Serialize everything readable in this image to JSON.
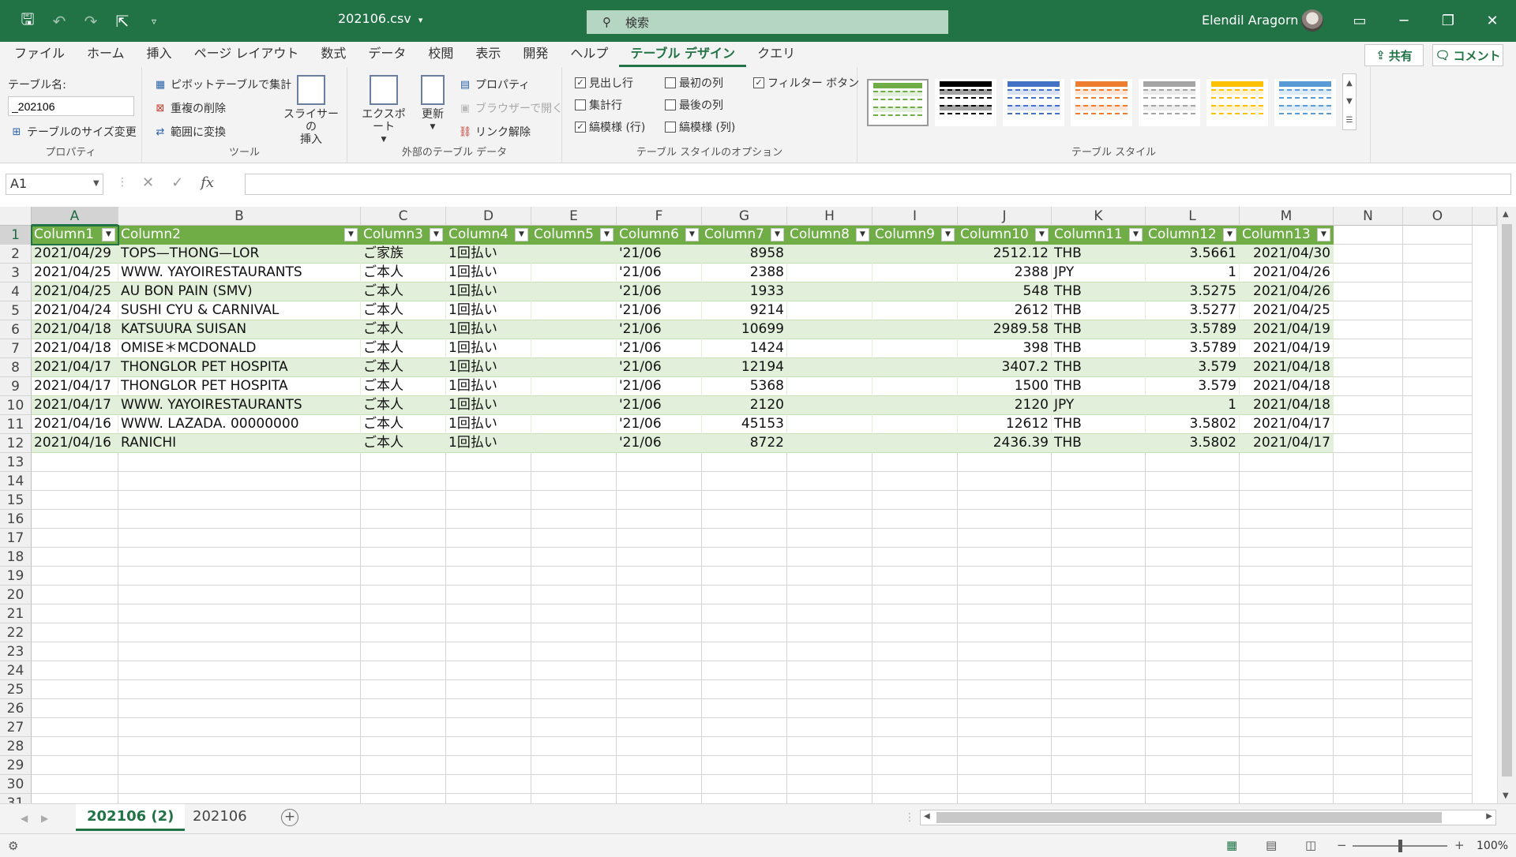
{
  "titlebar": {
    "doc_title": "202106.csv",
    "doc_title_caret": "▾",
    "search_placeholder": "検索",
    "user_name": "Elendil Aragorn"
  },
  "menu": {
    "tabs": [
      "ファイル",
      "ホーム",
      "挿入",
      "ページ レイアウト",
      "数式",
      "データ",
      "校閲",
      "表示",
      "開発",
      "ヘルプ",
      "テーブル デザイン",
      "クエリ"
    ],
    "active_index": 10,
    "share_label": "共有",
    "comment_label": "コメント"
  },
  "ribbon": {
    "properties": {
      "table_name_label": "テーブル名:",
      "table_name_value": "_202106",
      "resize_label": "テーブルのサイズ変更",
      "group_label": "プロパティ"
    },
    "tools": {
      "pivot_label": "ピボットテーブルで集計",
      "remove_dup_label": "重複の削除",
      "convert_label": "範囲に変換",
      "slicer_label_1": "スライサーの",
      "slicer_label_2": "挿入",
      "group_label": "ツール"
    },
    "external": {
      "export_label": "エクスポート",
      "refresh_label": "更新",
      "properties_label": "プロパティ",
      "browser_label": "ブラウザーで開く",
      "unlink_label": "リンク解除",
      "group_label": "外部のテーブル データ"
    },
    "style_options": {
      "header_row": {
        "label": "見出し行",
        "checked": true
      },
      "total_row": {
        "label": "集計行",
        "checked": false
      },
      "banded_rows": {
        "label": "縞模様 (行)",
        "checked": true
      },
      "first_column": {
        "label": "最初の列",
        "checked": false
      },
      "last_column": {
        "label": "最後の列",
        "checked": false
      },
      "banded_columns": {
        "label": "縞模様 (列)",
        "checked": false
      },
      "filter_button": {
        "label": "フィルター ボタン",
        "checked": true
      },
      "group_label": "テーブル スタイルのオプション"
    },
    "table_styles": {
      "group_label": "テーブル スタイル",
      "swatches": [
        {
          "head": "#70ad47",
          "band": "#e2efda",
          "selected": true
        },
        {
          "head": "#000000",
          "band": "#a5a5a5",
          "selected": false
        },
        {
          "head": "#4472c4",
          "band": "#d9e1f2",
          "selected": false
        },
        {
          "head": "#ed7d31",
          "band": "#fce4d6",
          "selected": false
        },
        {
          "head": "#a5a5a5",
          "band": "#ededed",
          "selected": false
        },
        {
          "head": "#ffc000",
          "band": "#fff2cc",
          "selected": false
        },
        {
          "head": "#5b9bd5",
          "band": "#ddebf7",
          "selected": false
        }
      ]
    }
  },
  "formula_bar": {
    "name_box": "A1",
    "cancel_icon": "✕",
    "enter_icon": "✓",
    "fx_label": "fx",
    "formula": ""
  },
  "grid": {
    "col_letters": [
      "A",
      "B",
      "C",
      "D",
      "E",
      "F",
      "G",
      "H",
      "I",
      "J",
      "K",
      "L",
      "M",
      "N",
      "O"
    ],
    "row_numbers": [
      "1",
      "2",
      "3",
      "4",
      "5",
      "6",
      "7",
      "8",
      "9",
      "10",
      "11",
      "12",
      "13",
      "14",
      "15",
      "16",
      "17",
      "18",
      "19",
      "20",
      "21",
      "22",
      "23",
      "24",
      "25",
      "26",
      "27",
      "28",
      "29",
      "30",
      "31"
    ],
    "headers": [
      "Column1",
      "Column2",
      "Column3",
      "Column4",
      "Column5",
      "Column6",
      "Column7",
      "Column8",
      "Column9",
      "Column10",
      "Column11",
      "Column12",
      "Column13"
    ],
    "rows": [
      [
        "2021/04/29",
        "TOPS—THONG—LOR",
        "ご家族",
        "1回払い",
        "",
        "'21/06",
        "8958",
        "",
        "",
        "2512.12",
        "THB",
        "3.5661",
        "2021/04/30"
      ],
      [
        "2021/04/25",
        "WWW. YAYOIRESTAURANTS",
        "ご本人",
        "1回払い",
        "",
        "'21/06",
        "2388",
        "",
        "",
        "2388",
        "JPY",
        "1",
        "2021/04/26"
      ],
      [
        "2021/04/25",
        "AU BON PAIN (SMV)",
        "ご本人",
        "1回払い",
        "",
        "'21/06",
        "1933",
        "",
        "",
        "548",
        "THB",
        "3.5275",
        "2021/04/26"
      ],
      [
        "2021/04/24",
        "SUSHI CYU & CARNIVAL",
        "ご本人",
        "1回払い",
        "",
        "'21/06",
        "9214",
        "",
        "",
        "2612",
        "THB",
        "3.5277",
        "2021/04/25"
      ],
      [
        "2021/04/18",
        "KATSUURA SUISAN",
        "ご本人",
        "1回払い",
        "",
        "'21/06",
        "10699",
        "",
        "",
        "2989.58",
        "THB",
        "3.5789",
        "2021/04/19"
      ],
      [
        "2021/04/18",
        "OMISE＊MCDONALD",
        "ご本人",
        "1回払い",
        "",
        "'21/06",
        "1424",
        "",
        "",
        "398",
        "THB",
        "3.5789",
        "2021/04/19"
      ],
      [
        "2021/04/17",
        "THONGLOR PET HOSPITA",
        "ご本人",
        "1回払い",
        "",
        "'21/06",
        "12194",
        "",
        "",
        "3407.2",
        "THB",
        "3.579",
        "2021/04/18"
      ],
      [
        "2021/04/17",
        "THONGLOR PET HOSPITA",
        "ご本人",
        "1回払い",
        "",
        "'21/06",
        "5368",
        "",
        "",
        "1500",
        "THB",
        "3.579",
        "2021/04/18"
      ],
      [
        "2021/04/17",
        "WWW. YAYOIRESTAURANTS",
        "ご本人",
        "1回払い",
        "",
        "'21/06",
        "2120",
        "",
        "",
        "2120",
        "JPY",
        "1",
        "2021/04/18"
      ],
      [
        "2021/04/16",
        "WWW. LAZADA. 00000000",
        "ご本人",
        "1回払い",
        "",
        "'21/06",
        "45153",
        "",
        "",
        "12612",
        "THB",
        "3.5802",
        "2021/04/17"
      ],
      [
        "2021/04/16",
        "RANICHI",
        "ご本人",
        "1回払い",
        "",
        "'21/06",
        "8722",
        "",
        "",
        "2436.39",
        "THB",
        "3.5802",
        "2021/04/17"
      ]
    ],
    "numeric_columns": [
      6,
      9,
      11,
      12
    ]
  },
  "sheets": {
    "tabs": [
      "202106 (2)",
      "202106"
    ],
    "active_index": 0,
    "add_label": "+"
  },
  "status": {
    "zoom_minus": "−",
    "zoom_plus": "+",
    "zoom_level": "100%",
    "zoom_fraction": 0.5
  }
}
